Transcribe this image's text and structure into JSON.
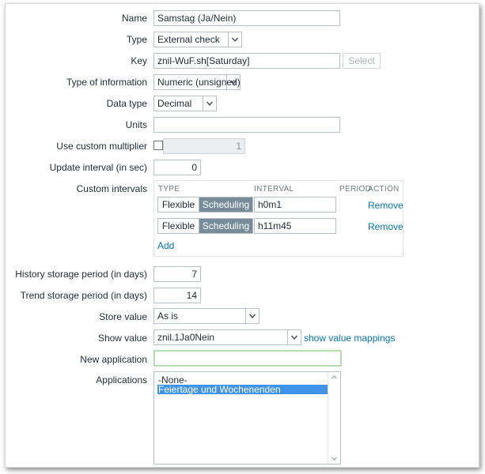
{
  "form": {
    "name": {
      "label": "Name",
      "value": "Samstag (Ja/Nein)"
    },
    "type": {
      "label": "Type",
      "value": "External check"
    },
    "key": {
      "label": "Key",
      "value": "znil-WuF.sh[Saturday]",
      "select_button": "Select"
    },
    "type_of_information": {
      "label": "Type of information",
      "value": "Numeric (unsigned)"
    },
    "data_type": {
      "label": "Data type",
      "value": "Decimal"
    },
    "units": {
      "label": "Units",
      "value": ""
    },
    "use_custom_multiplier": {
      "label": "Use custom multiplier",
      "value": "1",
      "checked": false
    },
    "update_interval": {
      "label": "Update interval (in sec)",
      "value": "0"
    },
    "custom_intervals": {
      "label": "Custom intervals",
      "headers": [
        "TYPE",
        "INTERVAL",
        "PERIOD",
        "ACTION"
      ],
      "rows": [
        {
          "flexible": "Flexible",
          "scheduling": "Scheduling",
          "interval": "h0m1",
          "action": "Remove"
        },
        {
          "flexible": "Flexible",
          "scheduling": "Scheduling",
          "interval": "h11m45",
          "action": "Remove"
        }
      ],
      "add": "Add"
    },
    "history_storage": {
      "label": "History storage period (in days)",
      "value": "7"
    },
    "trend_storage": {
      "label": "Trend storage period (in days)",
      "value": "14"
    },
    "store_value": {
      "label": "Store value",
      "value": "As is"
    },
    "show_value": {
      "label": "Show value",
      "value": "znil.1Ja0Nein",
      "link": "show value mappings"
    },
    "new_application": {
      "label": "New application",
      "value": ""
    },
    "applications": {
      "label": "Applications",
      "options": [
        "-None-",
        "Feiertage und Wochenenden"
      ],
      "selected": "Feiertage und Wochenenden"
    }
  }
}
